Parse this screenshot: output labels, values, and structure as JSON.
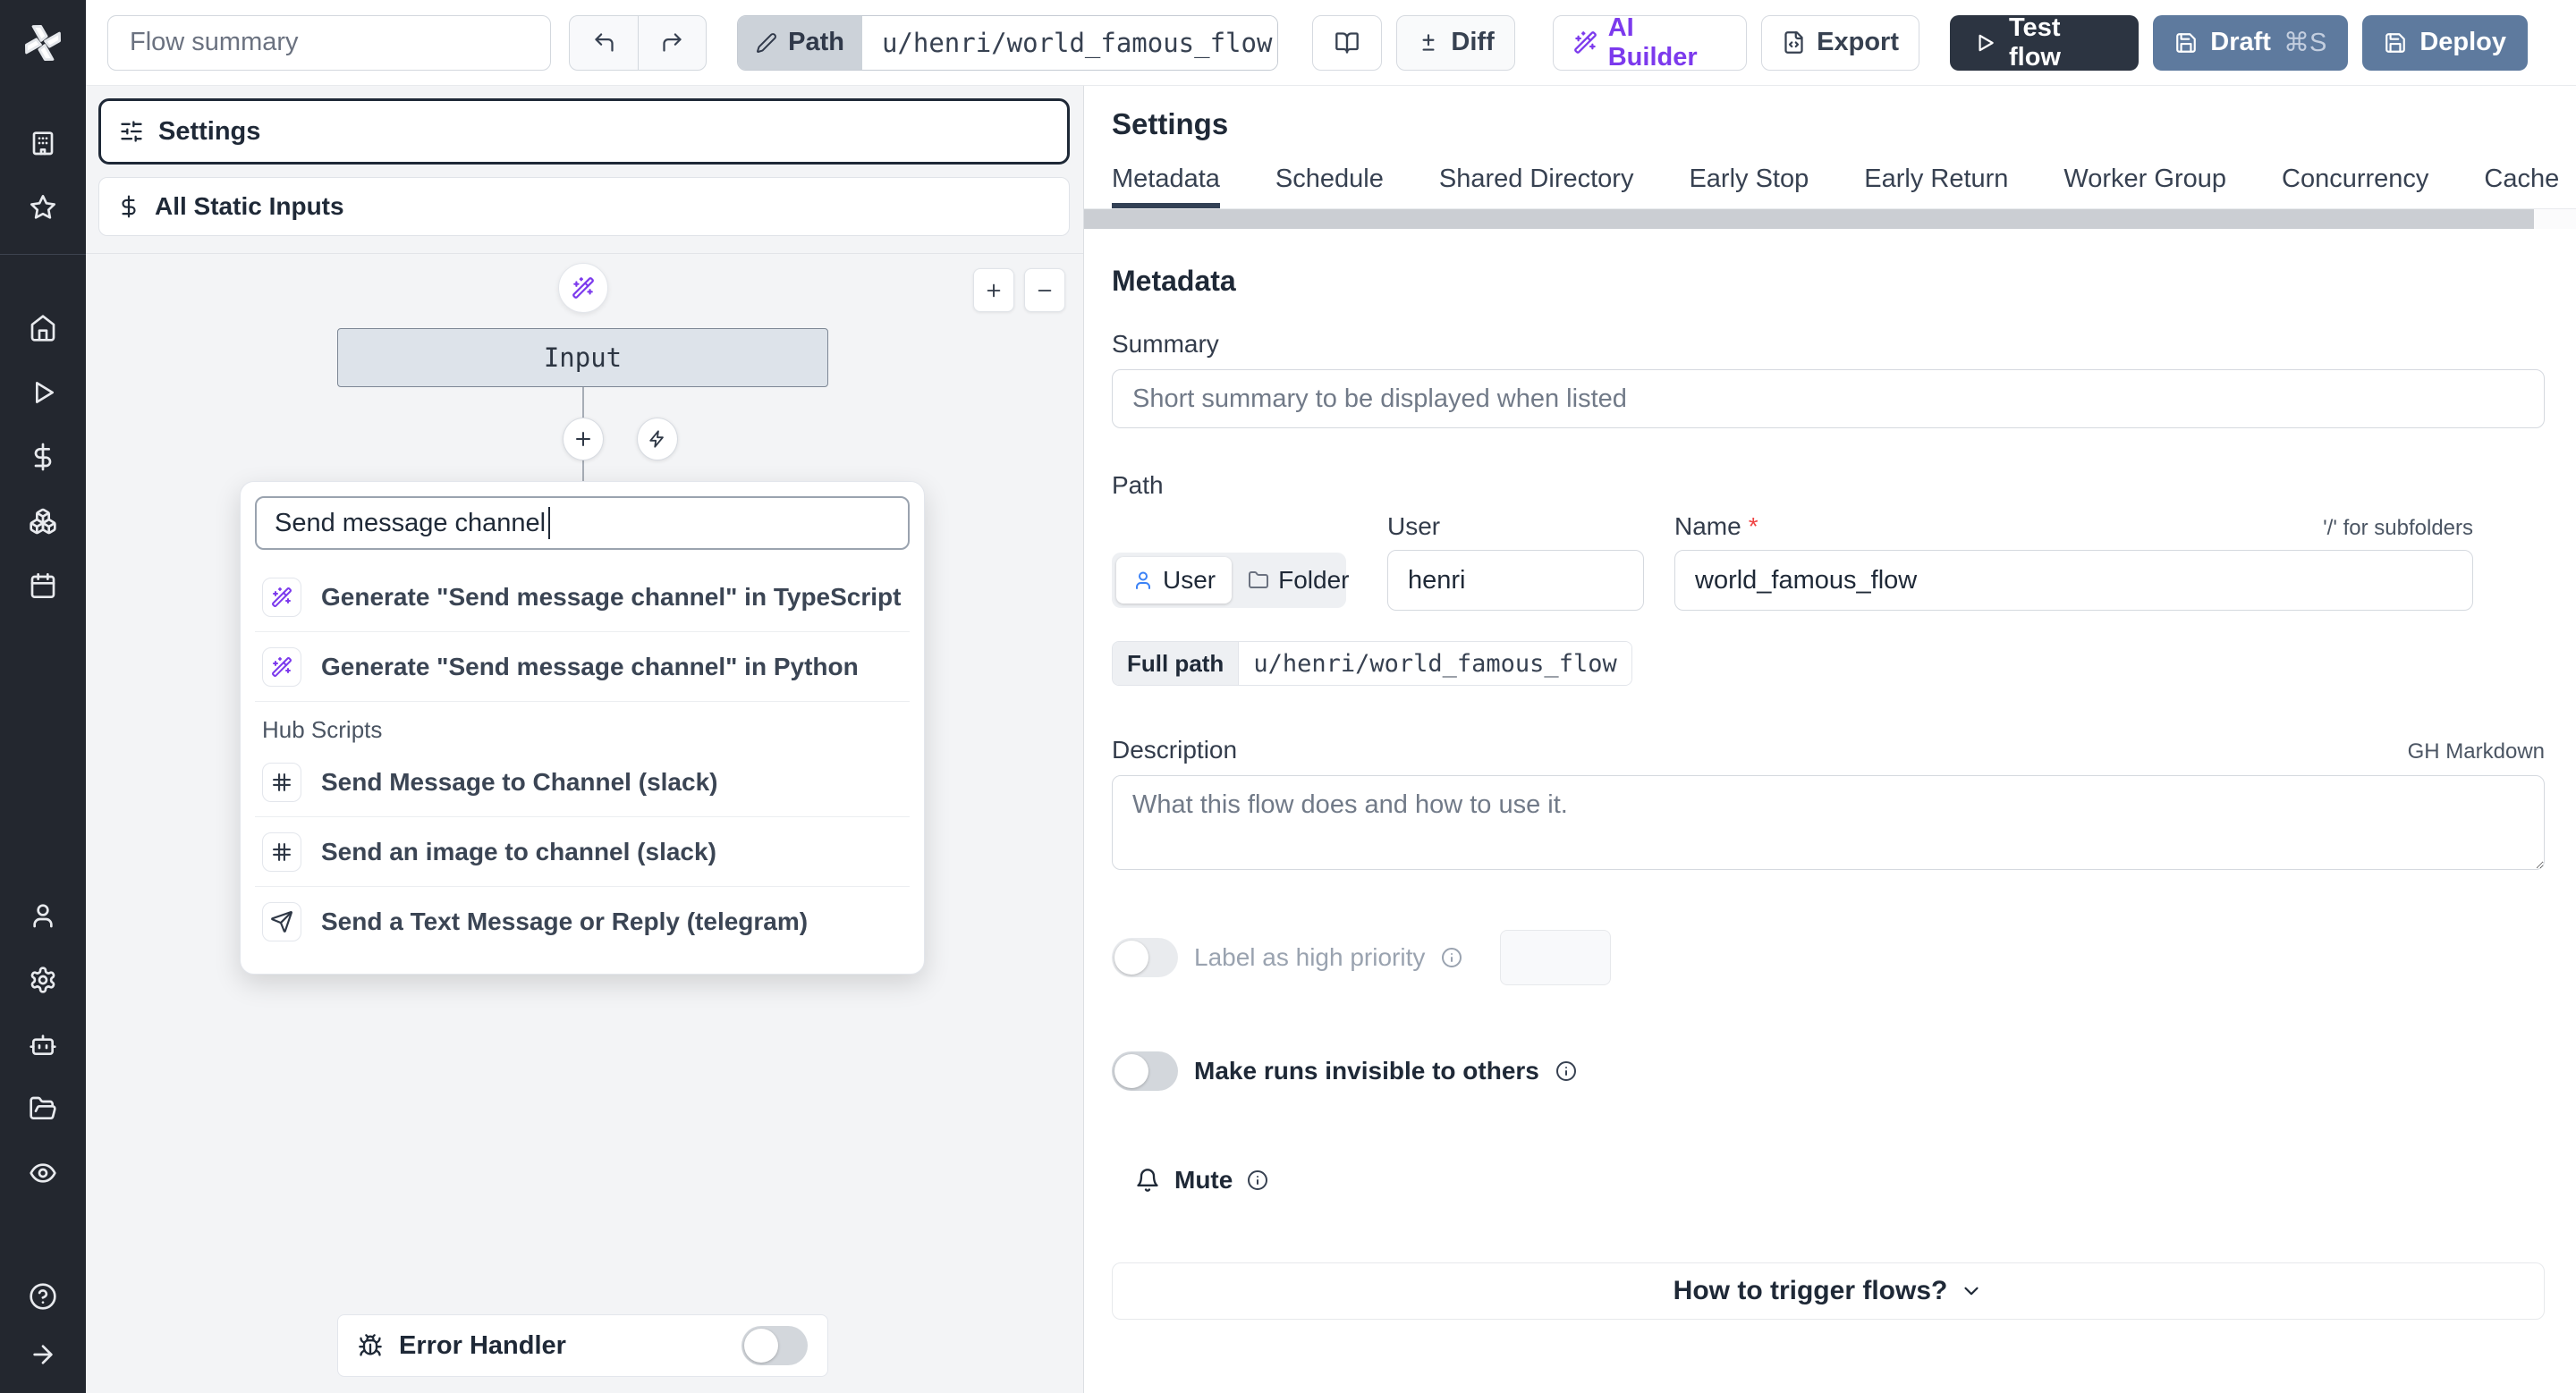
{
  "topbar": {
    "flow_summary_placeholder": "Flow summary",
    "path_label": "Path",
    "path_value": "u/henri/world_famous_flow",
    "diff_label": "Diff",
    "ai_builder_label": "AI Builder",
    "export_label": "Export",
    "test_flow_label": "Test flow",
    "draft_label": "Draft",
    "draft_shortcut": "⌘S",
    "deploy_label": "Deploy"
  },
  "flow_panel": {
    "settings_card_label": "Settings",
    "static_inputs_card_label": "All Static Inputs",
    "input_node_label": "Input",
    "zoom_in_label": "+",
    "zoom_out_label": "−",
    "search_value": "Send message channel",
    "ai_results": [
      {
        "icon": "wand-icon",
        "label": "Generate \"Send message channel\" in TypeScript"
      },
      {
        "icon": "wand-icon",
        "label": "Generate \"Send message channel\" in Python"
      }
    ],
    "hub_section_label": "Hub Scripts",
    "hub_results": [
      {
        "icon": "slack-icon",
        "label": "Send Message to Channel (slack)"
      },
      {
        "icon": "slack-icon",
        "label": "Send an image to channel (slack)"
      },
      {
        "icon": "telegram-icon",
        "label": "Send a Text Message or Reply (telegram)"
      }
    ],
    "error_handler_label": "Error Handler"
  },
  "settings_panel": {
    "title": "Settings",
    "tabs": [
      "Metadata",
      "Schedule",
      "Shared Directory",
      "Early Stop",
      "Early Return",
      "Worker Group",
      "Concurrency",
      "Cache"
    ],
    "active_tab": "Metadata",
    "section_title": "Metadata",
    "summary_label": "Summary",
    "summary_placeholder": "Short summary to be displayed when listed",
    "path_label": "Path",
    "owner_user_label": "User",
    "owner_folder_label": "Folder",
    "user_field_label": "User",
    "user_value": "henri",
    "name_field_label": "Name",
    "name_required_mark": "*",
    "subfolders_hint": "'/' for subfolders",
    "name_value": "world_famous_flow",
    "full_path_label": "Full path",
    "full_path_value": "u/henri/world_famous_flow",
    "description_label": "Description",
    "markdown_hint": "GH Markdown",
    "description_placeholder": "What this flow does and how to use it.",
    "high_priority_label": "Label as high priority",
    "invisible_runs_label": "Make runs invisible to others",
    "mute_label": "Mute",
    "trigger_button_label": "How to trigger flows?"
  },
  "colors": {
    "accent_purple": "#7c3aed",
    "deploy_blue": "#5e7a9e",
    "test_flow_dark": "#2c3441",
    "sidebar_bg": "#23272f",
    "canvas_bg": "#f3f4f6",
    "active_tab_underline": "#334155",
    "required_red": "#ef4444"
  }
}
